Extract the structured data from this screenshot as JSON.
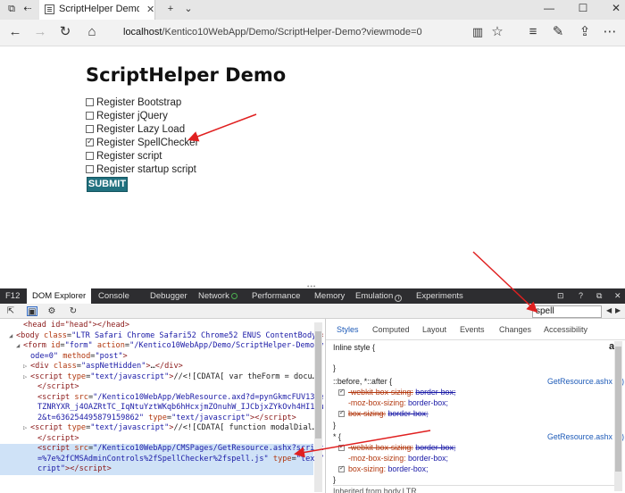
{
  "browser": {
    "tab_title": "ScriptHelper Demo - Da",
    "close_glyph": "✕",
    "new_tab_glyph": "+",
    "tab_list_glyph": "⌄",
    "address_host": "localhost",
    "address_path": "/Kentico10WebApp/Demo/ScriptHelper-Demo?viewmode=0"
  },
  "page": {
    "title": "ScriptHelper Demo",
    "checkboxes": [
      {
        "label": "Register Bootstrap",
        "checked": false
      },
      {
        "label": "Register jQuery",
        "checked": false
      },
      {
        "label": "Register Lazy Load",
        "checked": false
      },
      {
        "label": "Register SpellChecker",
        "checked": true
      },
      {
        "label": "Register script",
        "checked": false
      },
      {
        "label": "Register startup script",
        "checked": false
      }
    ],
    "submit_label": "SUBMIT"
  },
  "devtools": {
    "f12_label": "F12",
    "tabs": [
      "DOM Explorer",
      "Console",
      "Debugger",
      "Network",
      "Performance",
      "Memory",
      "Emulation",
      "Experiments"
    ],
    "right_icons": [
      "⊡",
      "?",
      "⧉",
      "✕"
    ],
    "search_value": "spell",
    "search_prev": "◀",
    "search_next": "▶",
    "dom_lines": [
      {
        "indent": 3,
        "twisty": "",
        "html": "<span class='tag'>&lt;head id=\"head\"&gt;&lt;/head&gt;</span>"
      },
      {
        "indent": 2,
        "twisty": "◢",
        "html": "<span class='tag'>&lt;body </span><span class='attr'>class</span>=<span class='val'>\"LTR Safari Chrome Safari52 Chrome52 ENUS ContentBody\"</span><span class='tag'>&gt;</span>"
      },
      {
        "indent": 3,
        "twisty": "◢",
        "html": "<span class='tag'>&lt;form </span><span class='attr'>id</span>=<span class='val'>\"form\"</span> <span class='attr'>action</span>=<span class='val'>\"/Kentico10WebApp/Demo/ScriptHelper-Demo?viewm</span>"
      },
      {
        "indent": 4,
        "twisty": "",
        "html": "<span class='val'>ode=0\"</span> <span class='attr'>method</span>=<span class='val'>\"post\"</span><span class='tag'>&gt;</span>"
      },
      {
        "indent": 4,
        "twisty": "▷",
        "html": "<span class='tag'>&lt;div </span><span class='attr'>class</span>=<span class='val'>\"aspNetHidden\"</span><span class='tag'>&gt;</span><span class='txt'>…</span><span class='tag'>&lt;/div&gt;</span>"
      },
      {
        "indent": 4,
        "twisty": "▷",
        "html": "<span class='tag'>&lt;script </span><span class='attr'>type</span>=<span class='val'>\"text/javascript\"</span><span class='tag'>&gt;</span><span class='txt'>//&lt;![CDATA[ var theForm = docu…</span>"
      },
      {
        "indent": 5,
        "twisty": "",
        "html": "<span class='tag'>&lt;/script&gt;</span>"
      },
      {
        "indent": 5,
        "twisty": "",
        "html": "<span class='tag'>&lt;script </span><span class='attr'>src</span>=<span class='val'>\"/Kentico10WebApp/WebResource.axd?d=pynGkmcFUV13He1Qd6_</span>"
      },
      {
        "indent": 5,
        "twisty": "",
        "html": "<span class='val'>TZNRYXR_j4OAZRtTC_IqNtuYztWKqb6hHcxjmZOnuhW_IJCbjxZYkOvh4HI18uSmYWg</span>"
      },
      {
        "indent": 5,
        "twisty": "",
        "html": "<span class='val'>2&amp;t=636254495879159862\"</span> <span class='attr'>type</span>=<span class='val'>\"text/javascript\"</span><span class='tag'>&gt;&lt;/script&gt;</span>"
      },
      {
        "indent": 4,
        "twisty": "▷",
        "html": "<span class='tag'>&lt;script </span><span class='attr'>type</span>=<span class='val'>\"text/javascript\"</span><span class='tag'>&gt;</span><span class='txt'>//&lt;![CDATA[ function modalDial…</span>"
      },
      {
        "indent": 5,
        "twisty": "",
        "html": "<span class='tag'>&lt;/script&gt;</span>"
      },
      {
        "indent": 5,
        "twisty": "",
        "hl": true,
        "html": "<span class='tag'>&lt;script </span><span class='attr'>src</span>=<span class='val'>\"/Kentico10WebApp/CMSPages/GetResource.ashx?scriptfile</span>"
      },
      {
        "indent": 5,
        "twisty": "",
        "hl": true,
        "html": "<span class='val'>=%7e%2fCMSAdminControls%2fSpellChecker%2fspell.js\"</span> <span class='attr'>type</span>=<span class='val'>\"text/javas</span>"
      },
      {
        "indent": 5,
        "twisty": "",
        "hl": true,
        "html": "<span class='val'>cript\"</span><span class='tag'>&gt;&lt;/script&gt;</span>"
      }
    ],
    "styles_tabs": [
      "Styles",
      "Computed",
      "Layout",
      "Events",
      "Changes",
      "Accessibility"
    ],
    "inline_style_label": "Inline style  {",
    "az_label": "a:",
    "open_brace": "{",
    "close_brace": "}",
    "rule1_selector": "::before, *::after  {",
    "rule1_source": "GetResource.ashx (3)",
    "rule2_selector": "*  {",
    "rule2_source": "GetResource.ashx (3)",
    "prop_rows": [
      {
        "name": "-webkit-box-sizing:",
        "value": "border-box;",
        "struck": true,
        "checkbox": true
      },
      {
        "name": "-moz-box-sizing:",
        "value": "border-box;",
        "struck": false,
        "checkbox": false
      },
      {
        "name": "box-sizing:",
        "value": "border-box;",
        "struck": true,
        "checkbox": true
      }
    ],
    "prop_rows_2": [
      {
        "name": "-webkit-box-sizing:",
        "value": "border-box;",
        "struck": true,
        "checkbox": true
      },
      {
        "name": "-moz-box-sizing:",
        "value": "border-box;",
        "struck": false,
        "checkbox": false
      },
      {
        "name": "box-sizing:",
        "value": "border-box;",
        "struck": false,
        "checkbox": true
      }
    ],
    "inherited_label": "Inherited from body.LTR"
  },
  "colors": {
    "accent": "#21717f",
    "arrow": "#e02020",
    "devtools_bar": "#2d2d30"
  }
}
